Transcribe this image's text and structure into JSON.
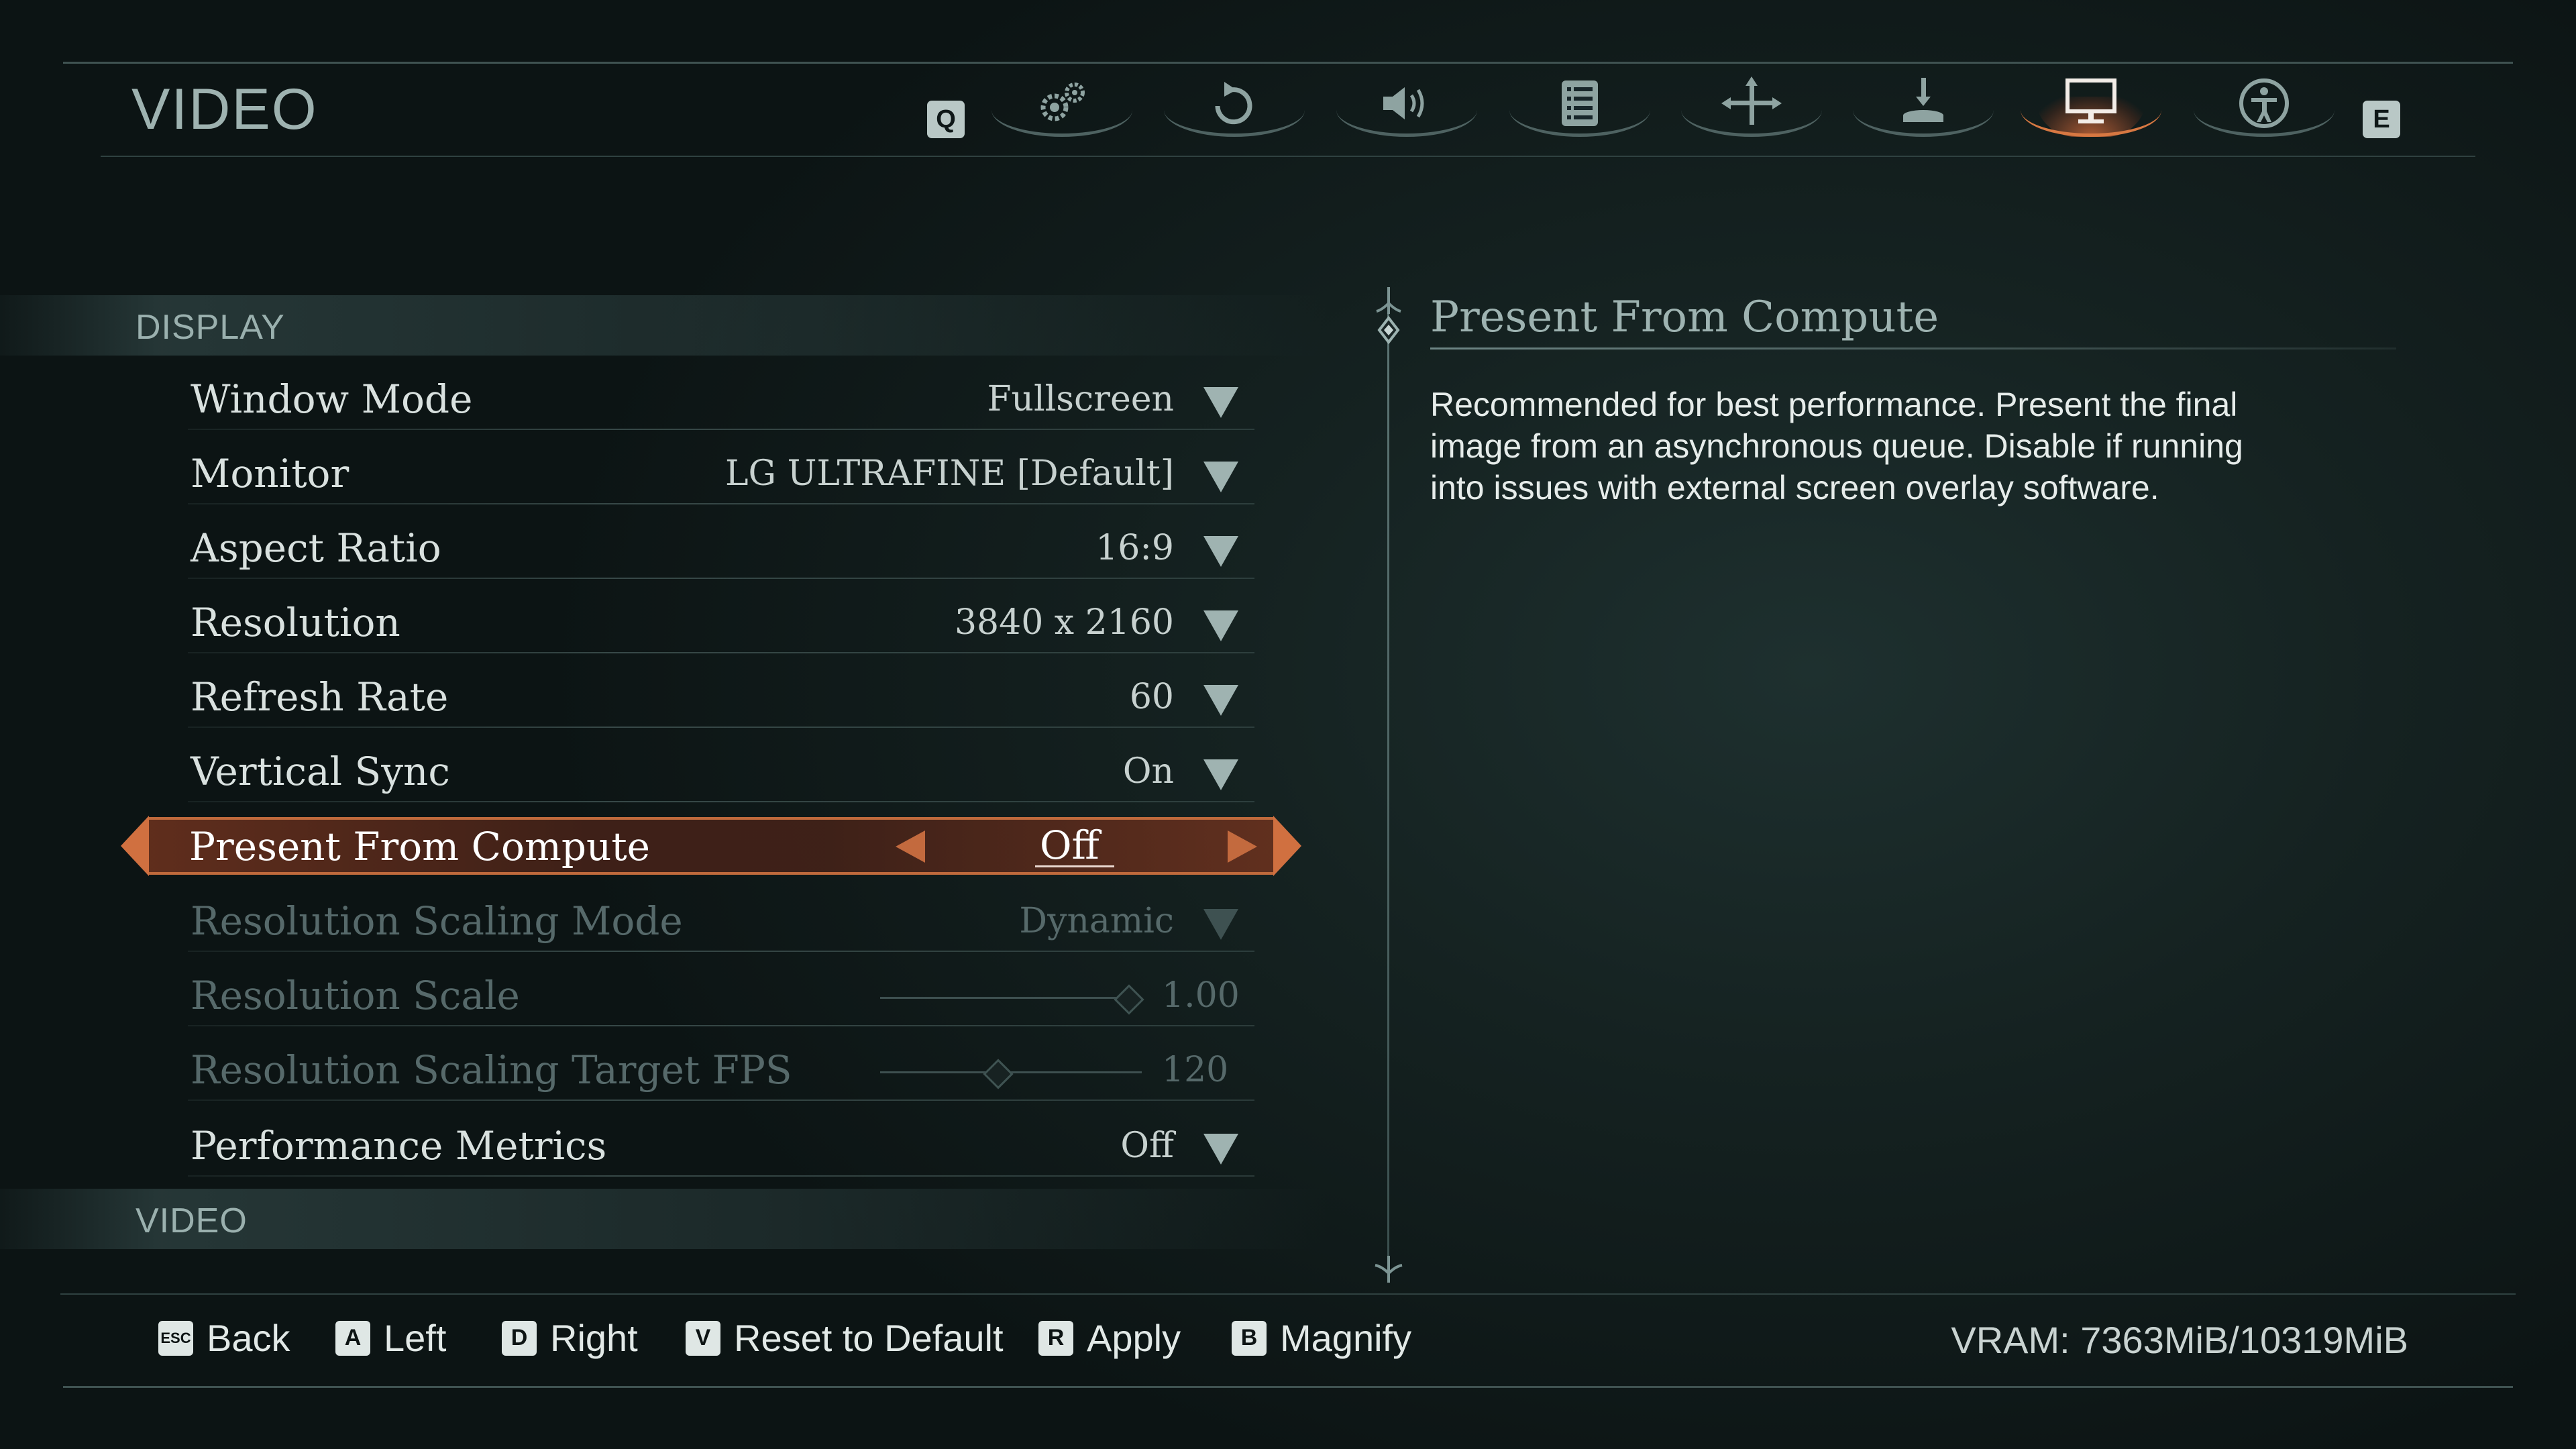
{
  "header": {
    "title": "VIDEO",
    "prev_key": "Q",
    "next_key": "E",
    "tabs": [
      {
        "icon": "gears-icon",
        "active": false
      },
      {
        "icon": "controller-rotate-icon",
        "active": false
      },
      {
        "icon": "speaker-icon",
        "active": false
      },
      {
        "icon": "list-icon",
        "active": false
      },
      {
        "icon": "move-arrows-icon",
        "active": false
      },
      {
        "icon": "download-icon",
        "active": false
      },
      {
        "icon": "monitor-icon",
        "active": true
      },
      {
        "icon": "accessibility-icon",
        "active": false
      }
    ]
  },
  "sections": {
    "display": "DISPLAY",
    "video": "VIDEO"
  },
  "settings": [
    {
      "label": "Window Mode",
      "value": "Fullscreen",
      "control": "dropdown",
      "enabled": true
    },
    {
      "label": "Monitor",
      "value": "LG ULTRAFINE [Default]",
      "control": "dropdown",
      "enabled": true
    },
    {
      "label": "Aspect Ratio",
      "value": "16:9",
      "control": "dropdown",
      "enabled": true
    },
    {
      "label": "Resolution",
      "value": "3840 x 2160",
      "control": "dropdown",
      "enabled": true
    },
    {
      "label": "Refresh Rate",
      "value": "60",
      "control": "dropdown",
      "enabled": true
    },
    {
      "label": "Vertical Sync",
      "value": "On",
      "control": "dropdown",
      "enabled": true
    },
    {
      "label": "Present From Compute",
      "value": "Off",
      "control": "toggle",
      "enabled": true,
      "selected": true
    },
    {
      "label": "Resolution Scaling Mode",
      "value": "Dynamic",
      "control": "dropdown",
      "enabled": false
    },
    {
      "label": "Resolution Scale",
      "value": "1.00",
      "control": "slider",
      "enabled": false,
      "slider_level": 0.95
    },
    {
      "label": "Resolution Scaling Target FPS",
      "value": "120",
      "control": "slider",
      "enabled": false,
      "slider_level": 0.45
    },
    {
      "label": "Performance Metrics",
      "value": "Off",
      "control": "dropdown",
      "enabled": true
    }
  ],
  "description": {
    "title": "Present From Compute",
    "body": "Recommended for best performance. Present the final image from an asynchronous queue. Disable if running into issues with external screen overlay software."
  },
  "footer": {
    "hints": [
      {
        "key": "ESC",
        "label": "Back"
      },
      {
        "key": "A",
        "label": "Left"
      },
      {
        "key": "D",
        "label": "Right"
      },
      {
        "key": "V",
        "label": "Reset to Default"
      },
      {
        "key": "R",
        "label": "Apply"
      },
      {
        "key": "B",
        "label": "Magnify"
      }
    ],
    "vram": "VRAM: 7363MiB/10319MiB"
  },
  "colors": {
    "accent": "#d07040",
    "text": "#d9e1df",
    "muted": "#56696a",
    "background": "#0d1515"
  }
}
